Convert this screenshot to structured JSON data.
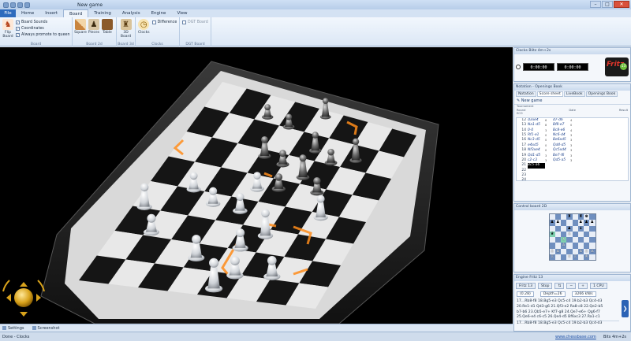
{
  "window": {
    "title": "New game"
  },
  "ribbon_tabs": {
    "file": "File",
    "items": [
      "Home",
      "Insert",
      "Board",
      "Training",
      "Analysis",
      "Engine",
      "View"
    ],
    "active": "Board"
  },
  "ribbon": {
    "board": {
      "flip": "Flip Board",
      "sounds": "Board Sounds",
      "coordinates": "Coordinates",
      "promote": "Always promote to queen",
      "label": "Board"
    },
    "board2d": {
      "square": "Square",
      "pieces": "Pieces",
      "table": "Table",
      "label": "Board 2d"
    },
    "board3d": {
      "button": "3D Board",
      "label": "Board 3d"
    },
    "clocks": {
      "button": "Clocks",
      "difference": "Difference",
      "label": "Clocks"
    },
    "dgt": {
      "button": "DGT Board",
      "label": "DGT Board"
    }
  },
  "bottom_tabs": {
    "settings": "Settings",
    "screenshot": "Screenshot"
  },
  "status": {
    "left": "Done - Clocks",
    "link": "www.chessbase.com",
    "right": "Bits 4m+2s"
  },
  "clocks_panel": {
    "title": "Clocks Blitz 4m+2s",
    "white_time": "0:00:00",
    "black_time": "0:00:00",
    "logo_text": "Fritz",
    "logo_version": "13"
  },
  "notation_panel": {
    "title": "Notation - Openings Book",
    "tabs": [
      "Notation",
      "Score sheet",
      "LiveBook",
      "Openings Book"
    ],
    "active_tab": "Score sheet",
    "game_name": "New game",
    "meta_labels": [
      "Tournament",
      "Round",
      "Date",
      "Result",
      "ECO"
    ],
    "moves": [
      {
        "n": "12",
        "w": "d3xe4",
        "wt": "6",
        "b": "d7-d6",
        "bt": "4"
      },
      {
        "n": "13",
        "w": "Na1-d5",
        "wt": "8",
        "b": "Bf8-e7",
        "bt": "0"
      },
      {
        "n": "14",
        "w": "0-0",
        "wt": "3",
        "b": "Bc8-e6",
        "bt": "4"
      },
      {
        "n": "15",
        "w": "Rf1-e1",
        "wt": "0",
        "b": "Nc6-d4",
        "bt": "3"
      },
      {
        "n": "16",
        "w": "Nc3-d5",
        "wt": "0",
        "b": "Be6xd5",
        "bt": "3"
      },
      {
        "n": "17",
        "w": "e4xd5",
        "wt": "0",
        "b": "Qd4-d5",
        "bt": "3"
      },
      {
        "n": "18",
        "w": "Nf3xe4",
        "wt": "0",
        "b": "Qc5xd4",
        "bt": "3"
      },
      {
        "n": "19",
        "w": "Qd1-d5",
        "wt": "3",
        "b": "Be7-f6",
        "bt": "3"
      },
      {
        "n": "20",
        "w": "c2-c3",
        "wt": "3",
        "b": "Qd5-a5",
        "bt": "3"
      },
      {
        "n": "21",
        "w": "Bc5-a6",
        "wt": "",
        "b": "",
        "bt": ""
      },
      {
        "n": "22",
        "w": "",
        "wt": "",
        "b": "",
        "bt": ""
      },
      {
        "n": "23",
        "w": "",
        "wt": "",
        "b": "",
        "bt": ""
      },
      {
        "n": "24",
        "w": "",
        "wt": "",
        "b": "",
        "bt": ""
      },
      {
        "n": "25",
        "w": "",
        "wt": "",
        "b": "",
        "bt": ""
      },
      {
        "n": "26",
        "w": "",
        "wt": "",
        "b": "",
        "bt": ""
      }
    ]
  },
  "control_board": {
    "title": "Control board 2D",
    "position": [
      [
        "",
        "",
        "",
        "♜",
        "",
        "♜",
        "♚",
        ""
      ],
      [
        "♟",
        "♟",
        "",
        "",
        "",
        "♟",
        "♟",
        "♟"
      ],
      [
        "",
        "",
        "",
        "♟",
        "",
        "♝",
        "",
        ""
      ],
      [
        "♛",
        "",
        "",
        "♙",
        "",
        "",
        "",
        ""
      ],
      [
        "",
        "",
        "♗",
        "",
        "",
        "",
        "",
        ""
      ],
      [
        "",
        "",
        "♙",
        "",
        "",
        "",
        "",
        ""
      ],
      [
        "♙",
        "♙",
        "",
        "",
        "",
        "♙",
        "♙",
        "♙"
      ],
      [
        "♖",
        "",
        "",
        "♕",
        "♖",
        "",
        "♔",
        ""
      ]
    ]
  },
  "engine_panel": {
    "title": "Engine Fritz 13",
    "engine": "Fritz 13",
    "stop": "Stop",
    "cpu": "1 CPU",
    "eval": "(0.28)",
    "depth": "Depth=26",
    "speed": "3266 kN/s",
    "pv_lines": [
      "17...Rb8-f8 18.Bg5-e3 Qc5-c4 19.b2-b3 Qc4-d3",
      "20.Re1-d1 Qd3-g6 21.Qf3-e2 Ra8-c8 22.Qe2-b5",
      "b7-b6 23.Qb5-e7+ Kf7-g8 24.Qe7-e6+ Qg6-f7",
      "25.Qe6-e4 c6-c5 26.Qe4-d5 Bf6xc3 27.Ra1-c1"
    ],
    "pv_bottom": "17...Rb8-f8 18.Bg5-e3 Qc5-c4 19.b2-b3 Qc4-d3"
  }
}
